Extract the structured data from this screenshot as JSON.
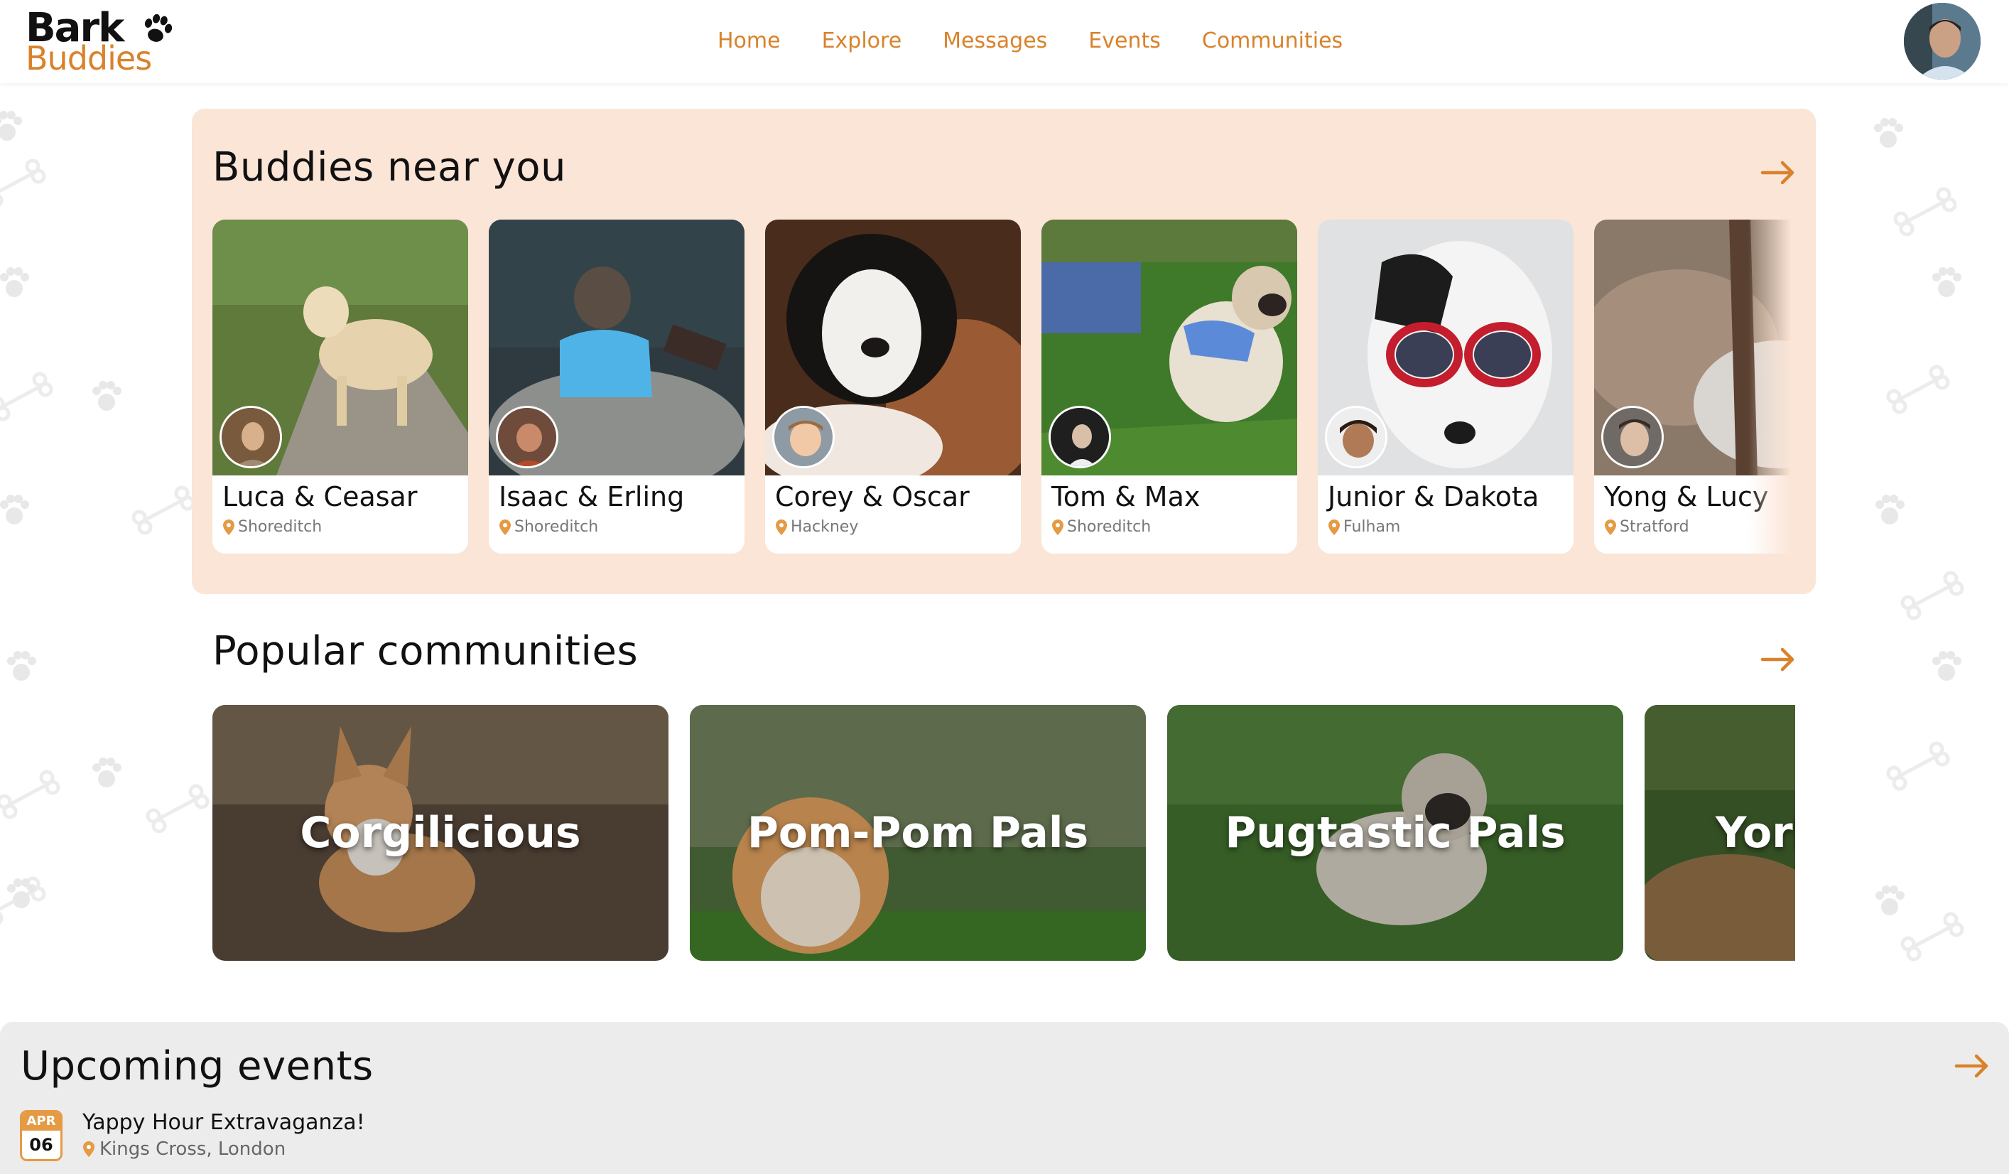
{
  "brand": {
    "line1": "Bark",
    "line2": "Buddies",
    "accent": "#d9822b",
    "panel_bg": "#fbe5d7"
  },
  "nav": {
    "items": [
      {
        "label": "Home"
      },
      {
        "label": "Explore"
      },
      {
        "label": "Messages"
      },
      {
        "label": "Events"
      },
      {
        "label": "Communities"
      }
    ]
  },
  "buddies": {
    "title": "Buddies near you",
    "cards": [
      {
        "name": "Luca & Ceasar",
        "location": "Shoreditch"
      },
      {
        "name": "Isaac & Erling",
        "location": "Shoreditch"
      },
      {
        "name": "Corey & Oscar",
        "location": "Hackney"
      },
      {
        "name": "Tom & Max",
        "location": "Shoreditch"
      },
      {
        "name": "Junior & Dakota",
        "location": "Fulham"
      },
      {
        "name": "Yong & Lucy",
        "location": "Stratford"
      }
    ]
  },
  "communities": {
    "title": "Popular communities",
    "items": [
      {
        "name": "Corgilicious"
      },
      {
        "name": "Pom-Pom Pals"
      },
      {
        "name": "Pugtastic Pals"
      },
      {
        "name": "York"
      }
    ]
  },
  "events": {
    "title": "Upcoming events",
    "items": [
      {
        "month": "APR",
        "day": "06",
        "title": "Yappy Hour Extravaganza!",
        "location": "Kings Cross, London"
      }
    ]
  }
}
